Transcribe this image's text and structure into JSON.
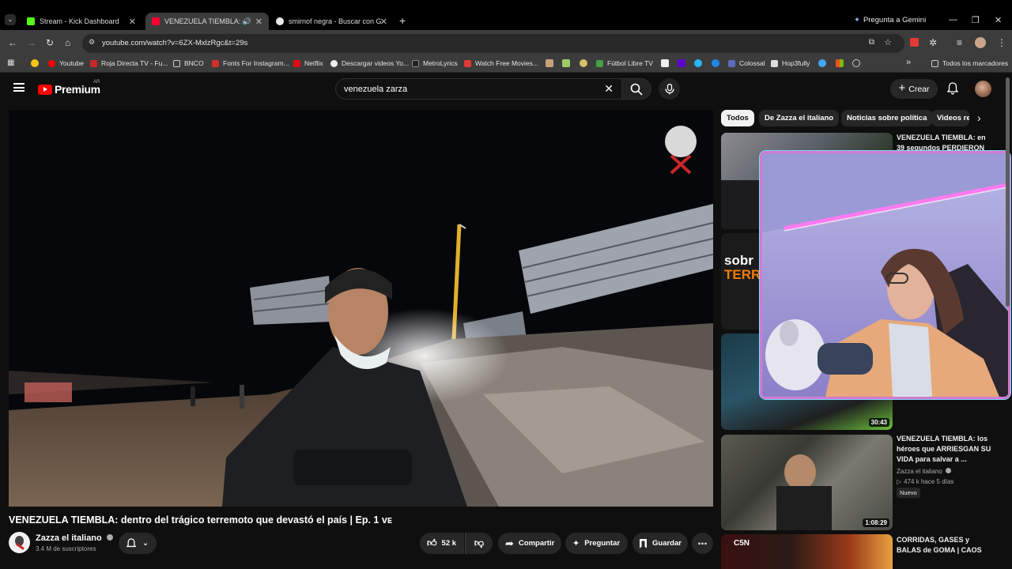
{
  "browser": {
    "tabs": [
      {
        "title": "Stream - Kick Dashboard",
        "favicon_color": "#53fc18"
      },
      {
        "title": "VENEZUELA TIEMBLA: dentr",
        "favicon_color": "#ff0033"
      },
      {
        "title": "smirnof negra - Buscar con Goo",
        "favicon_color": "#e8e8e8"
      }
    ],
    "gemini_label": "Pregunta a Gemini",
    "url": "youtube.com/watch?v=6ZX-MxlzRgc&t=29s",
    "bookmarks": [
      "Youtube",
      "Roja Directa TV - Fu...",
      "BNCO",
      "Fonts For Instagram...",
      "Netflix",
      "Descargar videos Yo...",
      "MetroLyrics",
      "Watch Free Movies...",
      "Fútbol Libre TV",
      "Colossal",
      "Hop3fully"
    ],
    "all_bookmarks": "Todos los marcadores"
  },
  "youtube": {
    "logo_text": "Premium",
    "country_code": "AR",
    "search_query": "venezuela zarza",
    "create_label": "Crear",
    "video": {
      "title": "VENEZUELA TIEMBLA: dentro del trágico terremoto que devastó el país | Ep. 1 ᴠᴇ",
      "channel": "Zazza el italiano",
      "subscribers": "3.4 M de suscriptores",
      "likes": "52 k",
      "share_label": "Compartir",
      "ask_label": "Preguntar",
      "save_label": "Guardar"
    },
    "chips": [
      "Todos",
      "De Zazza el italiano",
      "Noticias sobre política",
      "Videos re"
    ],
    "recommended": [
      {
        "title": "VENEZUELA TIEMBLA: en 39 segundos PERDIERON",
        "duration": ""
      },
      {
        "title": "",
        "duration": ""
      },
      {
        "title": "",
        "duration": "30:43"
      },
      {
        "title": "VENEZUELA TIEMBLA: los héroes que ARRIESGAN SU VIDA para salvar a ...",
        "channel": "Zazza el italiano",
        "meta": "474 k  hace 5 días",
        "badge": "Nuevo",
        "duration": "1:08:29"
      },
      {
        "title": "CORRIDAS, GASES y BALAS de GOMA | CAOS total en las",
        "thumb_text": "C5N",
        "duration": ""
      }
    ]
  }
}
